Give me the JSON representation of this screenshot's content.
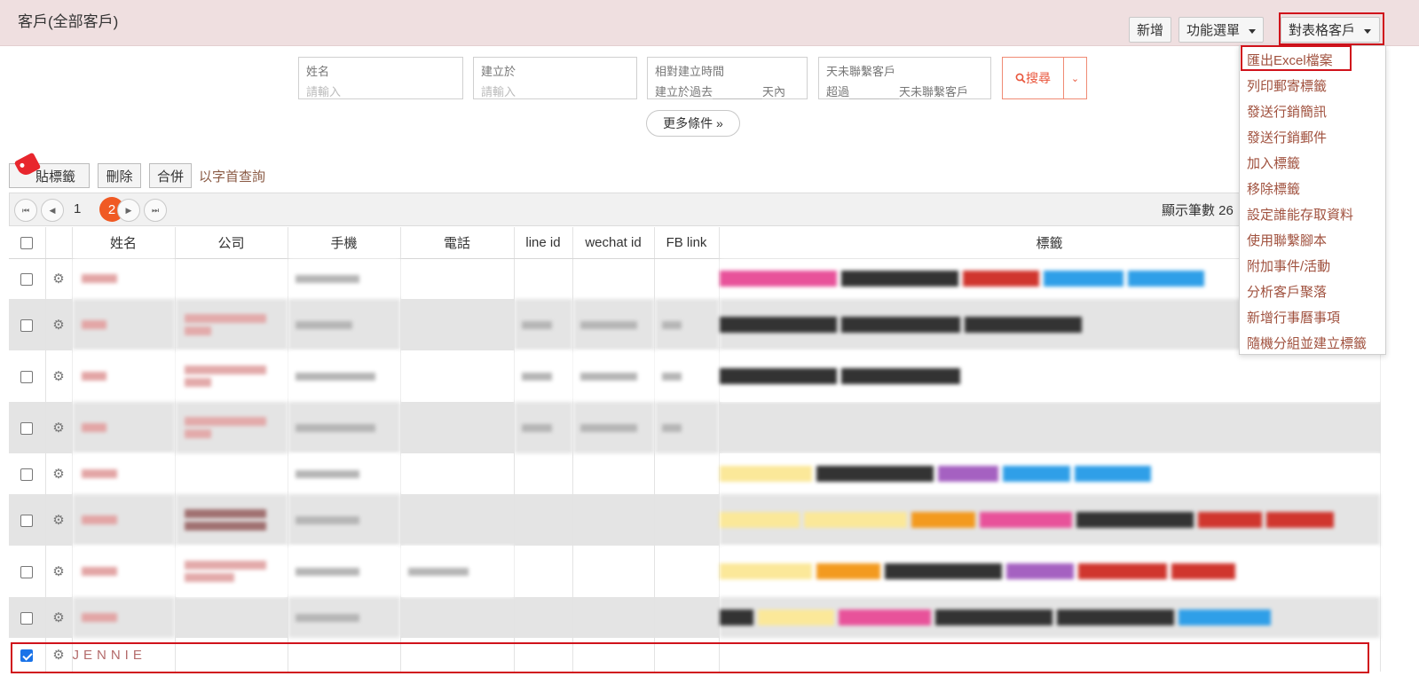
{
  "header": {
    "title": "客戶(全部客戶)",
    "add_label": "新增",
    "function_menu_label": "功能選單",
    "table_action_label": "對表格客戶"
  },
  "filters": {
    "name": {
      "label": "姓名",
      "placeholder": "請輸入"
    },
    "created": {
      "label": "建立於",
      "placeholder": "請輸入"
    },
    "relative": {
      "label": "相對建立時間",
      "prefix": "建立於過去",
      "suffix": "天內"
    },
    "no_contact": {
      "label": "天未聯繫客戶",
      "prefix": "超過",
      "suffix": "天未聯繫客戶"
    },
    "search_label": "搜尋",
    "more_label": "更多條件"
  },
  "actions": {
    "tag_label": "貼標籤",
    "delete_label": "刪除",
    "merge_label": "合併",
    "alpha_link": "以字首查詢"
  },
  "pager": {
    "page1": "1",
    "page2": "2",
    "show_count": "顯示筆數 26"
  },
  "table": {
    "columns": [
      "姓名",
      "公司",
      "手機",
      "電話",
      "line id",
      "wechat id",
      "FB link",
      "標籤"
    ],
    "last_row_name": "JENNIE",
    "last_row_checked": true
  },
  "menu": {
    "items": [
      "匯出Excel檔案",
      "列印郵寄標籤",
      "發送行銷簡訊",
      "發送行銷郵件",
      "加入標籤",
      "移除標籤",
      "設定誰能存取資料",
      "使用聯繫腳本",
      "附加事件/活動",
      "分析客戶聚落",
      "新增行事曆事項",
      "隨機分組並建立標籤"
    ]
  },
  "colors": {
    "accent": "#f05a24",
    "highlight_box": "#d0121b",
    "header_bg": "#efdfe0",
    "menu_text": "#a0513e"
  }
}
